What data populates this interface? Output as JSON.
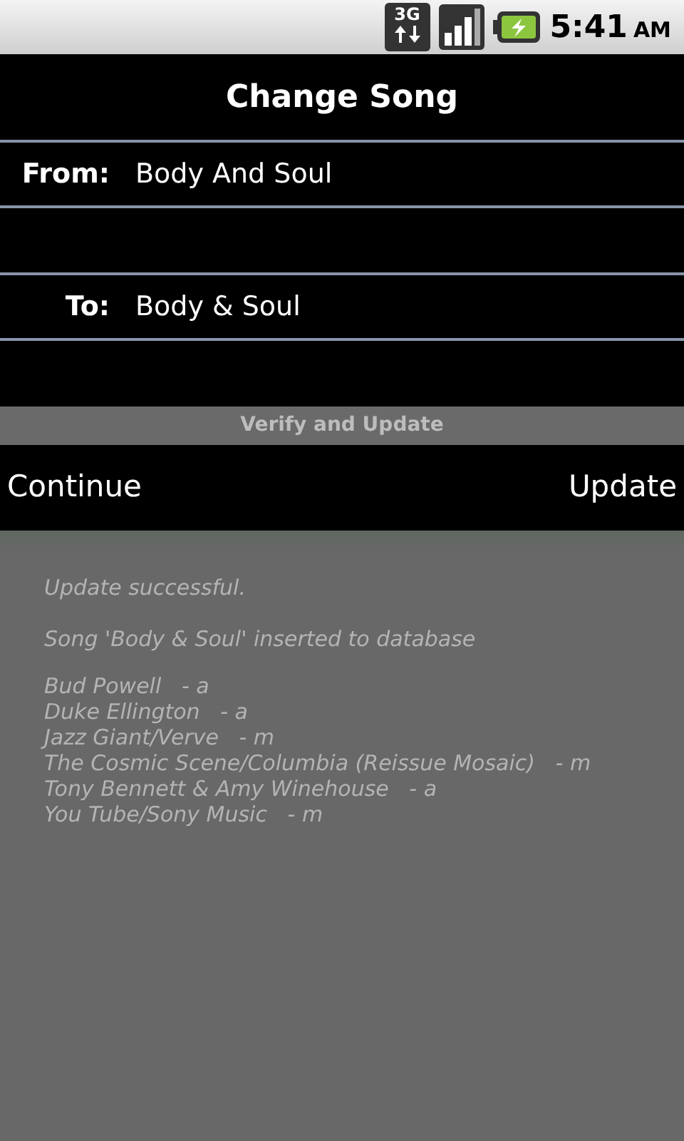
{
  "status_bar": {
    "network": "3G",
    "time": "5:41",
    "meridiem": "AM"
  },
  "title": "Change Song",
  "fields": [
    {
      "label": "From:",
      "value": "Body And Soul"
    },
    {
      "label": "To:",
      "value": "Body & Soul"
    }
  ],
  "section_header": "Verify and Update",
  "buttons": [
    "Continue",
    "Update"
  ],
  "output": {
    "status": "Update successful.",
    "message": "Song 'Body & Soul' inserted to database",
    "lines": [
      "Bud Powell   - a",
      "Duke Ellington   - a",
      "Jazz Giant/Verve   - m",
      "The Cosmic Scene/Columbia (Reissue Mosaic)   - m",
      "Tony Bennett & Amy Winehouse   - a",
      "You Tube/Sony Music   - m"
    ]
  }
}
